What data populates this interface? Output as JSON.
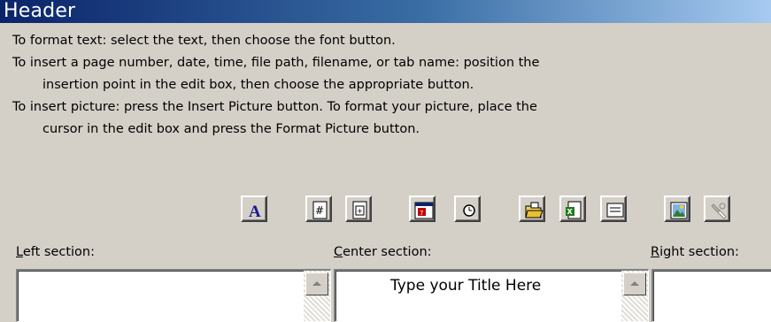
{
  "title": "Header",
  "instructions": [
    "To format text:  select the text, then choose the font button.",
    "To insert a page number, date, time, file path, filename, or tab name:  position the",
    "insertion point in the edit box, then choose the appropriate button.",
    "To insert picture: press the Insert Picture button.  To format your picture, place the",
    "cursor in the edit box and press the Format Picture button."
  ],
  "toolbar": {
    "buttons": [
      {
        "icon": "font-icon"
      },
      {
        "icon": "page-number-icon"
      },
      {
        "icon": "total-pages-icon"
      },
      {
        "icon": "date-icon"
      },
      {
        "icon": "time-icon"
      },
      {
        "icon": "file-path-icon"
      },
      {
        "icon": "filename-icon"
      },
      {
        "icon": "sheet-name-icon"
      },
      {
        "icon": "insert-picture-icon"
      },
      {
        "icon": "format-picture-icon"
      }
    ]
  },
  "sections": {
    "left": {
      "label_underline": "L",
      "label_rest": "eft section:",
      "value": ""
    },
    "center": {
      "label_underline": "C",
      "label_rest": "enter section:",
      "value": "Type your Title Here"
    },
    "right": {
      "label_underline": "R",
      "label_rest": "ight section:",
      "value": ""
    }
  }
}
